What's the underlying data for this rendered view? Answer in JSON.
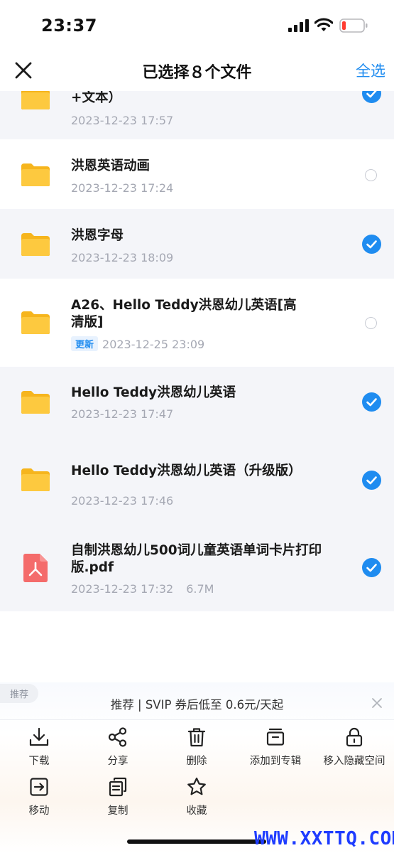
{
  "status": {
    "time": "23:37"
  },
  "header": {
    "title": "已选择８个文件",
    "select_all": "全选"
  },
  "files": [
    {
      "name": "+文本）",
      "meta": "2023-12-23 17:57",
      "selected": true,
      "type": "folder"
    },
    {
      "name": "洪恩英语动画",
      "meta": "2023-12-23 17:24",
      "selected": false,
      "type": "folder"
    },
    {
      "name": "洪恩字母",
      "meta": "2023-12-23 18:09",
      "selected": true,
      "type": "folder"
    },
    {
      "name": "A26、Hello Teddy洪恩幼儿英语[高清版]",
      "badge": "更新",
      "meta": "2023-12-25 23:09",
      "selected": false,
      "type": "folder"
    },
    {
      "name": "Hello Teddy洪恩幼儿英语",
      "meta": "2023-12-23 17:47",
      "selected": true,
      "type": "folder"
    },
    {
      "name": "Hello Teddy洪恩幼儿英语（升级版）",
      "meta": "2023-12-23 17:46",
      "selected": true,
      "type": "folder"
    },
    {
      "name": "自制洪恩幼儿500词儿童英语单词卡片打印版.pdf",
      "meta": "2023-12-23 17:32",
      "size": "6.7M",
      "selected": true,
      "type": "pdf"
    }
  ],
  "bottom": {
    "tag": "推荐",
    "promo": "推荐 | SVIP 券后低至 0.6元/天起",
    "actions": [
      {
        "label": "下载",
        "icon": "download-icon"
      },
      {
        "label": "分享",
        "icon": "share-icon"
      },
      {
        "label": "删除",
        "icon": "trash-icon"
      },
      {
        "label": "添加到专辑",
        "icon": "album-icon"
      },
      {
        "label": "移入隐藏空间",
        "icon": "lock-icon"
      },
      {
        "label": "移动",
        "icon": "move-icon"
      },
      {
        "label": "复制",
        "icon": "copy-icon"
      },
      {
        "label": "收藏",
        "icon": "star-icon"
      }
    ]
  },
  "watermark": "WWW.XXTTQ.COM",
  "colors": {
    "accent": "#1f8cf0",
    "folder": "#fdc43a",
    "pdf": "#f46b6b",
    "battery_low": "#ff3b30"
  }
}
